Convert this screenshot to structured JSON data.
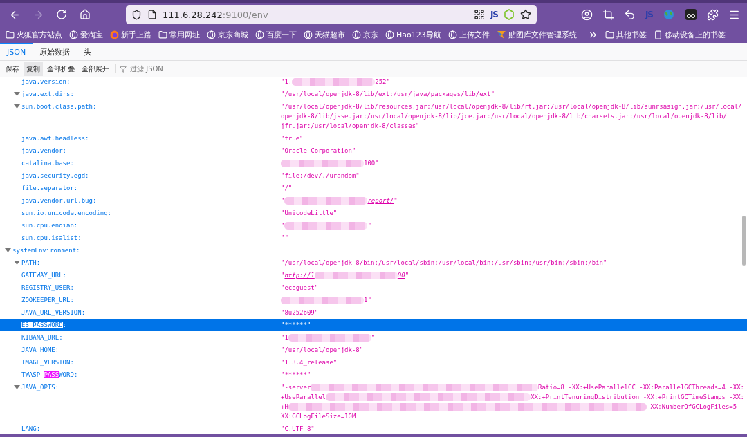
{
  "browser": {
    "url_host": "111.6.28.242",
    "url_rest": ":9100/env",
    "url_badges": [
      {
        "kind": "qr"
      },
      {
        "kind": "text",
        "text": "JS"
      },
      {
        "kind": "node"
      },
      {
        "kind": "star"
      }
    ],
    "toolbar_icons": [
      {
        "kind": "account"
      },
      {
        "kind": "crop"
      },
      {
        "kind": "undo"
      },
      {
        "kind": "text",
        "text": "JS"
      },
      {
        "kind": "globe"
      },
      {
        "kind": "mask"
      },
      {
        "kind": "puzzle"
      },
      {
        "kind": "menu"
      }
    ],
    "bookmarks": [
      {
        "kind": "folder",
        "label": "火狐官方站点"
      },
      {
        "kind": "globe",
        "label": "爱淘宝"
      },
      {
        "kind": "firefox",
        "label": "新手上路"
      },
      {
        "kind": "folder",
        "label": "常用网址"
      },
      {
        "kind": "globe",
        "label": "京东商城"
      },
      {
        "kind": "globe",
        "label": "百度一下"
      },
      {
        "kind": "globe",
        "label": "天猫超市"
      },
      {
        "kind": "globe",
        "label": "京东"
      },
      {
        "kind": "globe",
        "label": "Hao123导航"
      },
      {
        "kind": "globe",
        "label": "上传文件"
      },
      {
        "kind": "app",
        "label": "贴图库文件管理系统"
      }
    ],
    "other_bookmarks": [
      {
        "kind": "folder",
        "label": "其他书签"
      },
      {
        "kind": "phone",
        "label": "移动设备上的书签"
      }
    ]
  },
  "tabs": [
    {
      "label": "JSON",
      "selected": true
    },
    {
      "label": "原始数据",
      "selected": false
    },
    {
      "label": "头",
      "selected": false
    }
  ],
  "toolbar": {
    "buttons": [
      {
        "label": "保存",
        "hovered": false
      },
      {
        "label": "复制",
        "hovered": true
      },
      {
        "label": "全部折叠",
        "hovered": false
      },
      {
        "label": "全部展开",
        "hovered": false
      }
    ],
    "filter": {
      "placeholder": "过滤 JSON"
    }
  },
  "properties_tail": [
    {
      "key": "java.version:",
      "expanded": false,
      "selected": false,
      "value_lines": [
        [
          {
            "kind": "text",
            "text": "\"1."
          },
          {
            "kind": "smudge"
          },
          {
            "kind": "text",
            "text": "252\""
          }
        ]
      ]
    },
    {
      "key": "java.ext.dirs:",
      "expanded": true,
      "selected": false,
      "value_lines": [
        [
          {
            "kind": "text",
            "text": "\"/usr/local/openjdk-8/lib/ext:/usr/java/packages/lib/ext\""
          }
        ]
      ]
    },
    {
      "key": "sun.boot.class.path:",
      "expanded": true,
      "selected": false,
      "value_lines": [
        [
          {
            "kind": "text",
            "text": "\"/usr/local/openjdk-8/lib/resources.jar:/usr/local/openjdk-8/lib/rt.jar:/usr/local/openjdk-8/lib/sunrsasign.jar:/usr/local/"
          }
        ],
        [
          {
            "kind": "text",
            "text": "openjdk-8/lib/jsse.jar:/usr/local/openjdk-8/lib/jce.jar:/usr/local/openjdk-8/lib/charsets.jar:/usr/local/openjdk-8/lib/"
          }
        ],
        [
          {
            "kind": "text",
            "text": "jfr.jar:/usr/local/openjdk-8/classes\""
          }
        ]
      ]
    },
    {
      "key": "java.awt.headless:",
      "expanded": false,
      "selected": false,
      "value_lines": [
        [
          {
            "kind": "text",
            "text": "\"true\""
          }
        ]
      ]
    },
    {
      "key": "java.vendor:",
      "expanded": false,
      "selected": false,
      "value_lines": [
        [
          {
            "kind": "text",
            "text": "\"Oracle Corporation\""
          }
        ]
      ]
    },
    {
      "key": "catalina.base:",
      "expanded": false,
      "selected": false,
      "value_lines": [
        [
          {
            "kind": "smudge"
          },
          {
            "kind": "text",
            "text": "100\""
          }
        ]
      ]
    },
    {
      "key": "java.security.egd:",
      "expanded": false,
      "selected": false,
      "value_lines": [
        [
          {
            "kind": "text",
            "text": "\"file:/dev/./urandom\""
          }
        ]
      ]
    },
    {
      "key": "file.separator:",
      "expanded": false,
      "selected": false,
      "value_lines": [
        [
          {
            "kind": "text",
            "text": "\"/\""
          }
        ]
      ]
    },
    {
      "key": "java.vendor.url.bug:",
      "expanded": false,
      "selected": false,
      "value_lines": [
        [
          {
            "kind": "text",
            "text": "\""
          },
          {
            "kind": "smudge"
          },
          {
            "kind": "link",
            "text": "report/"
          },
          {
            "kind": "text",
            "text": "\""
          }
        ]
      ]
    },
    {
      "key": "sun.io.unicode.encoding:",
      "expanded": false,
      "selected": false,
      "value_lines": [
        [
          {
            "kind": "text",
            "text": "\"UnicodeLittle\""
          }
        ]
      ]
    },
    {
      "key": "sun.cpu.endian:",
      "expanded": false,
      "selected": false,
      "value_lines": [
        [
          {
            "kind": "text",
            "text": "\""
          },
          {
            "kind": "smudge"
          },
          {
            "kind": "text",
            "text": "\""
          }
        ]
      ]
    },
    {
      "key": "sun.cpu.isalist:",
      "expanded": false,
      "selected": false,
      "value_lines": [
        [
          {
            "kind": "text",
            "text": "\"\""
          }
        ]
      ]
    }
  ],
  "environment": {
    "key": "systemEnvironment:",
    "expanded": true,
    "children": [
      {
        "key": "PATH:",
        "expanded": true,
        "selected": false,
        "value_lines": [
          [
            {
              "kind": "text",
              "text": "\"/usr/local/openjdk-8/bin:/usr/local/sbin:/usr/local/bin:/usr/sbin:/usr/bin:/sbin:/bin\""
            }
          ]
        ]
      },
      {
        "key": "GATEWAY_URL:",
        "expanded": false,
        "selected": false,
        "value_lines": [
          [
            {
              "kind": "text",
              "text": "\""
            },
            {
              "kind": "link",
              "text": "http://1"
            },
            {
              "kind": "smudge"
            },
            {
              "kind": "link",
              "text": "00"
            },
            {
              "kind": "text",
              "text": "\""
            }
          ]
        ]
      },
      {
        "key": "REGISTRY_USER:",
        "expanded": false,
        "selected": false,
        "value_lines": [
          [
            {
              "kind": "text",
              "text": "\"ecoguest\""
            }
          ]
        ]
      },
      {
        "key": "ZOOKEEPER_URL:",
        "expanded": false,
        "selected": false,
        "value_lines": [
          [
            {
              "kind": "smudge"
            },
            {
              "kind": "text",
              "text": "1\""
            }
          ]
        ]
      },
      {
        "key": "JAVA_URL_VERSION:",
        "expanded": false,
        "selected": false,
        "value_lines": [
          [
            {
              "kind": "text",
              "text": "\"8u252b09\""
            }
          ]
        ]
      },
      {
        "key_parts": [
          {
            "text": "ES_PASSWORD",
            "highlighted": true
          },
          {
            "text": ":",
            "highlighted": false
          }
        ],
        "expanded": false,
        "selected": true,
        "value_lines": [
          [
            {
              "kind": "text",
              "text": "\"******\""
            }
          ]
        ]
      },
      {
        "key": "KIBANA_URL:",
        "expanded": false,
        "selected": false,
        "value_lines": [
          [
            {
              "kind": "text",
              "text": "\"1"
            },
            {
              "kind": "smudge"
            },
            {
              "kind": "text",
              "text": "\""
            }
          ]
        ]
      },
      {
        "key": "JAVA_HOME:",
        "expanded": false,
        "selected": false,
        "value_lines": [
          [
            {
              "kind": "text",
              "text": "\"/usr/local/openjdk-8\""
            }
          ]
        ]
      },
      {
        "key": "IMAGE_VERSION:",
        "expanded": false,
        "selected": false,
        "value_lines": [
          [
            {
              "kind": "text",
              "text": "\"1.3.4_release\""
            }
          ]
        ]
      },
      {
        "key_parts": [
          {
            "text": "TWASP_",
            "highlighted": false
          },
          {
            "text": "PASS",
            "highlighted": true
          },
          {
            "text": "WORD:",
            "highlighted": false
          }
        ],
        "expanded": false,
        "selected": false,
        "value_lines": [
          [
            {
              "kind": "text",
              "text": "\"******\""
            }
          ]
        ]
      },
      {
        "key": "JAVA_OPTS:",
        "expanded": true,
        "selected": false,
        "value_lines": [
          [
            {
              "kind": "text",
              "text": "\"-server"
            },
            {
              "kind": "smudge"
            },
            {
              "kind": "text",
              "text": "Ratio=8 -XX:+UseParallelGC -XX:ParallelGCThreads=4 -XX:"
            }
          ],
          [
            {
              "kind": "text",
              "text": "+UseParallel"
            },
            {
              "kind": "smudge"
            },
            {
              "kind": "text",
              "text": "XX:+PrintTenuringDistribution -XX:+PrintGCTimeStamps -XX:"
            }
          ],
          [
            {
              "kind": "text",
              "text": "+H"
            },
            {
              "kind": "smudge"
            },
            {
              "kind": "text",
              "text": "-XX:NumberOfGCLogFiles=5 -"
            }
          ],
          [
            {
              "kind": "text",
              "text": "XX:GCLogFileSize=10M"
            }
          ]
        ]
      },
      {
        "key": "LANG:",
        "expanded": false,
        "selected": false,
        "value_lines": [
          [
            {
              "kind": "text",
              "text": "\"C.UTF-8\""
            }
          ]
        ]
      }
    ]
  }
}
